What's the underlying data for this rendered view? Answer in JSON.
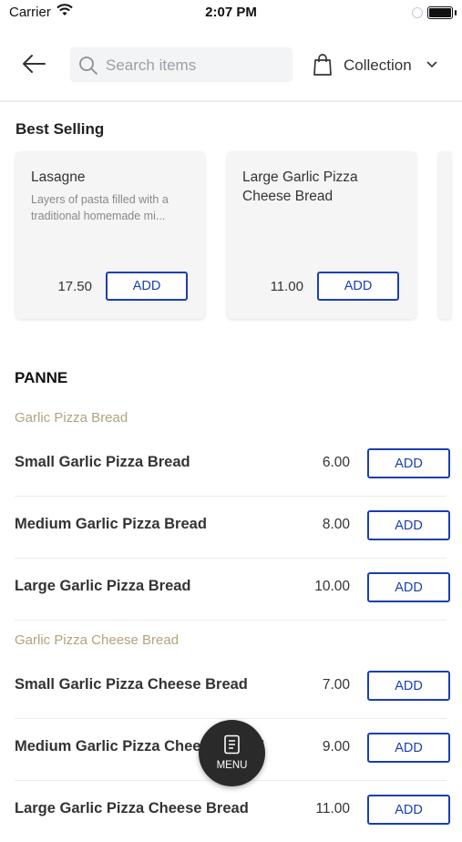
{
  "status": {
    "carrier": "Carrier",
    "time": "2:07 PM"
  },
  "header": {
    "search_placeholder": "Search items",
    "collection_label": "Collection"
  },
  "best_selling": {
    "title": "Best Selling",
    "items": [
      {
        "name": "Lasagne",
        "desc": "Layers of pasta filled with a traditional homemade mi...",
        "price": "17.50",
        "button": "ADD"
      },
      {
        "name": "Large Garlic Pizza Cheese Bread",
        "desc": "",
        "price": "11.00",
        "button": "ADD"
      }
    ]
  },
  "category": {
    "title": "PANNE",
    "groups": [
      {
        "title": "Garlic Pizza Bread",
        "items": [
          {
            "name": "Small Garlic Pizza Bread",
            "price": "6.00",
            "button": "ADD"
          },
          {
            "name": "Medium Garlic Pizza Bread",
            "price": "8.00",
            "button": "ADD"
          },
          {
            "name": "Large Garlic Pizza Bread",
            "price": "10.00",
            "button": "ADD"
          }
        ]
      },
      {
        "title": "Garlic Pizza Cheese Bread",
        "items": [
          {
            "name": "Small Garlic Pizza Cheese Bread",
            "price": "7.00",
            "button": "ADD"
          },
          {
            "name": "Medium Garlic Pizza Cheese Bread",
            "price": "9.00",
            "button": "ADD"
          },
          {
            "name": "Large Garlic Pizza Cheese Bread",
            "price": "11.00",
            "button": "ADD"
          }
        ]
      }
    ]
  },
  "menu_button": {
    "label": "MENU"
  },
  "colors": {
    "accent": "#1a3fb0",
    "subheading": "#b0a47e",
    "fab": "#2a2a2a"
  }
}
